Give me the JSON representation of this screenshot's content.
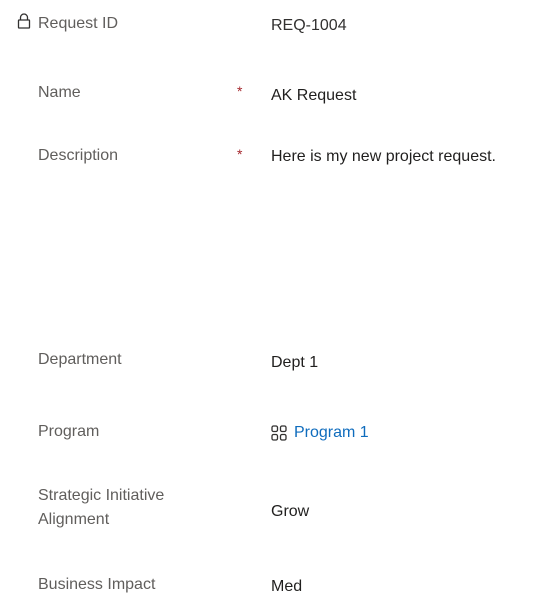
{
  "fields": {
    "request_id": {
      "label": "Request ID",
      "value": "REQ-1004",
      "icon": "lock-icon"
    },
    "name": {
      "label": "Name",
      "required_mark": "*",
      "value": "AK Request"
    },
    "description": {
      "label": "Description",
      "required_mark": "*",
      "value": "Here is my new project request."
    },
    "department": {
      "label": "Department",
      "value": "Dept 1"
    },
    "program": {
      "label": "Program",
      "value": "Program 1",
      "icon": "entity-grid-icon"
    },
    "strategic_alignment": {
      "label_line1": "Strategic Initiative",
      "label_line2": "Alignment",
      "value": "Grow"
    },
    "business_impact": {
      "label": "Business Impact",
      "value": "Med"
    }
  },
  "colors": {
    "label": "#605e5c",
    "value": "#201f1e",
    "required": "#a4262c",
    "link": "#0f6cbd"
  }
}
